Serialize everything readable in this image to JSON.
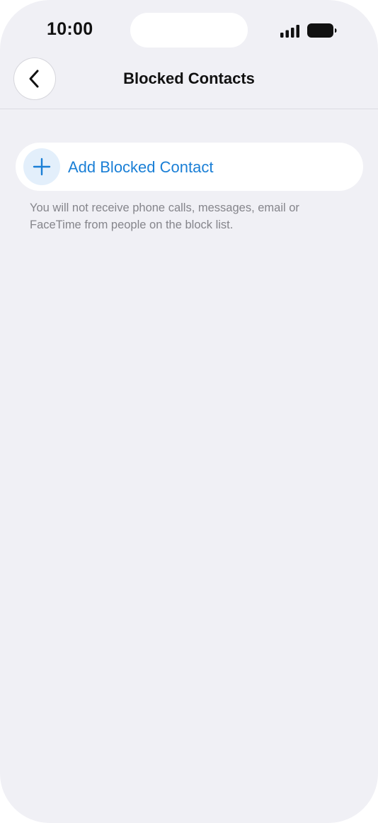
{
  "status_bar": {
    "time": "10:00",
    "icons": [
      "signal-icon",
      "battery-icon"
    ]
  },
  "nav": {
    "title": "Blocked Contacts",
    "back_icon": "chevron-left-icon"
  },
  "add_row": {
    "icon": "plus-icon",
    "label": "Add Blocked Contact"
  },
  "footnote": "You will not receive phone calls, messages, email or FaceTime from people on the block list.",
  "colors": {
    "background": "#f0f0f5",
    "accent": "#1a7fd6",
    "accent_tint": "#e3effb",
    "secondary_text": "#85858b"
  }
}
